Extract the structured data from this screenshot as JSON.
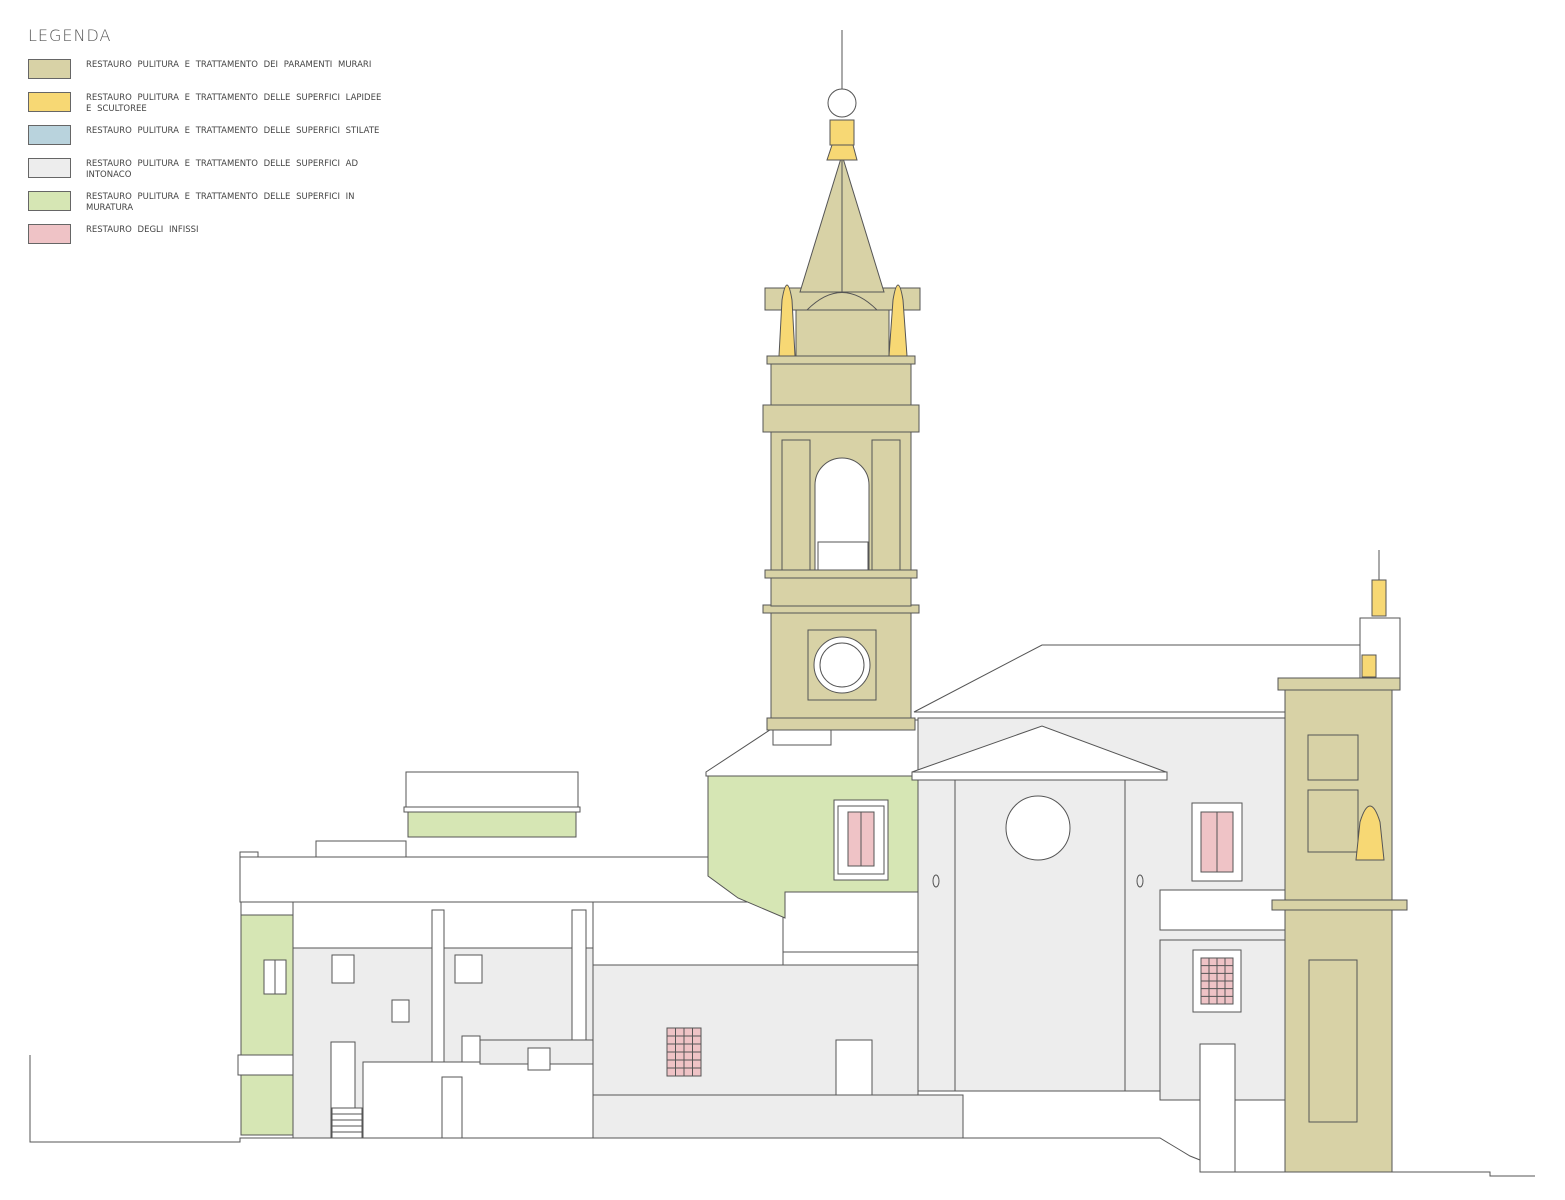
{
  "legend": {
    "title": "LEGENDA",
    "items": [
      {
        "label": "RESTAURO PULITURA E TRATTAMENTO DEI PARAMENTI MURARI",
        "color": "#d8d2a6"
      },
      {
        "label": "RESTAURO PULITURA E TRATTAMENTO DELLE SUPERFICI LAPIDEE E SCULTOREE",
        "color": "#f7d874"
      },
      {
        "label": "RESTAURO PULITURA E TRATTAMENTO DELLE SUPERFICI STILATE",
        "color": "#b9d3dd"
      },
      {
        "label": "RESTAURO PULITURA E TRATTAMENTO DELLE SUPERFICI AD INTONACO",
        "color": "#ededed"
      },
      {
        "label": "RESTAURO PULITURA E TRATTAMENTO DELLE SUPERFICI IN MURATURA",
        "color": "#d6e6b4"
      },
      {
        "label": "RESTAURO DEGLI INFISSI",
        "color": "#efc3c6"
      }
    ]
  },
  "colors": {
    "stone": "#d8d2a6",
    "sculpture": "#f7d874",
    "plaster": "#ededed",
    "masonry": "#d6e6b4",
    "fixtures": "#efc3c6",
    "line": "#555555"
  }
}
